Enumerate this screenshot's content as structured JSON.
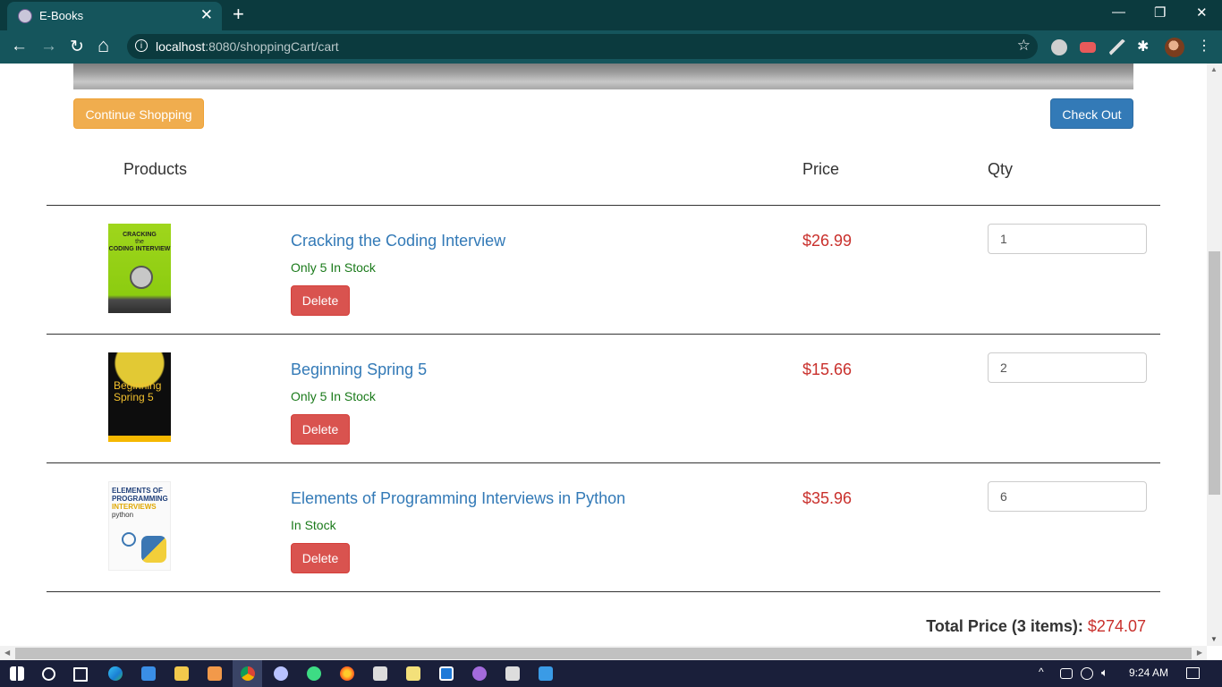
{
  "browser": {
    "tab_title": "E-Books",
    "tab_close": "✕",
    "new_tab": "+",
    "url_host": "localhost",
    "url_rest": ":8080/shoppingCart/cart",
    "window": {
      "minimize": "—",
      "restore": "❐",
      "close": "✕"
    },
    "nav": {
      "back": "←",
      "forward": "→",
      "reload": "↻",
      "home": "⌂"
    },
    "star": "☆",
    "menu": "⋮"
  },
  "page": {
    "continue_label": "Continue Shopping",
    "checkout_label": "Check Out",
    "headers": {
      "products": "Products",
      "price": "Price",
      "qty": "Qty"
    },
    "items": [
      {
        "title": "Cracking the Coding Interview",
        "stock": "Only 5 In Stock",
        "delete_label": "Delete",
        "price": "$26.99",
        "qty": "1",
        "cover_text": [
          "CRACKING",
          "the",
          "CODING INTERVIEW"
        ]
      },
      {
        "title": "Beginning Spring 5",
        "stock": "Only 5 In Stock",
        "delete_label": "Delete",
        "price": "$15.66",
        "qty": "2",
        "cover_text": [
          "Beginning",
          "Spring 5"
        ]
      },
      {
        "title": "Elements of Programming Interviews in Python",
        "stock": "In Stock",
        "delete_label": "Delete",
        "price": "$35.96",
        "qty": "6",
        "cover_text": [
          "ELEMENTS OF",
          "PROGRAMMING",
          "INTERVIEWS",
          "python"
        ]
      }
    ],
    "total_label": "Total Price (3 items):",
    "total_value": "$274.07"
  },
  "taskbar": {
    "time": "9:24 AM"
  },
  "colors": {
    "chrome_dark": "#0b3a3e",
    "chrome_tab": "#15555c",
    "warning": "#f0ad4e",
    "primary": "#337ab7",
    "danger": "#d9534f",
    "price": "#c9302c",
    "stock": "#1a7a1a"
  }
}
